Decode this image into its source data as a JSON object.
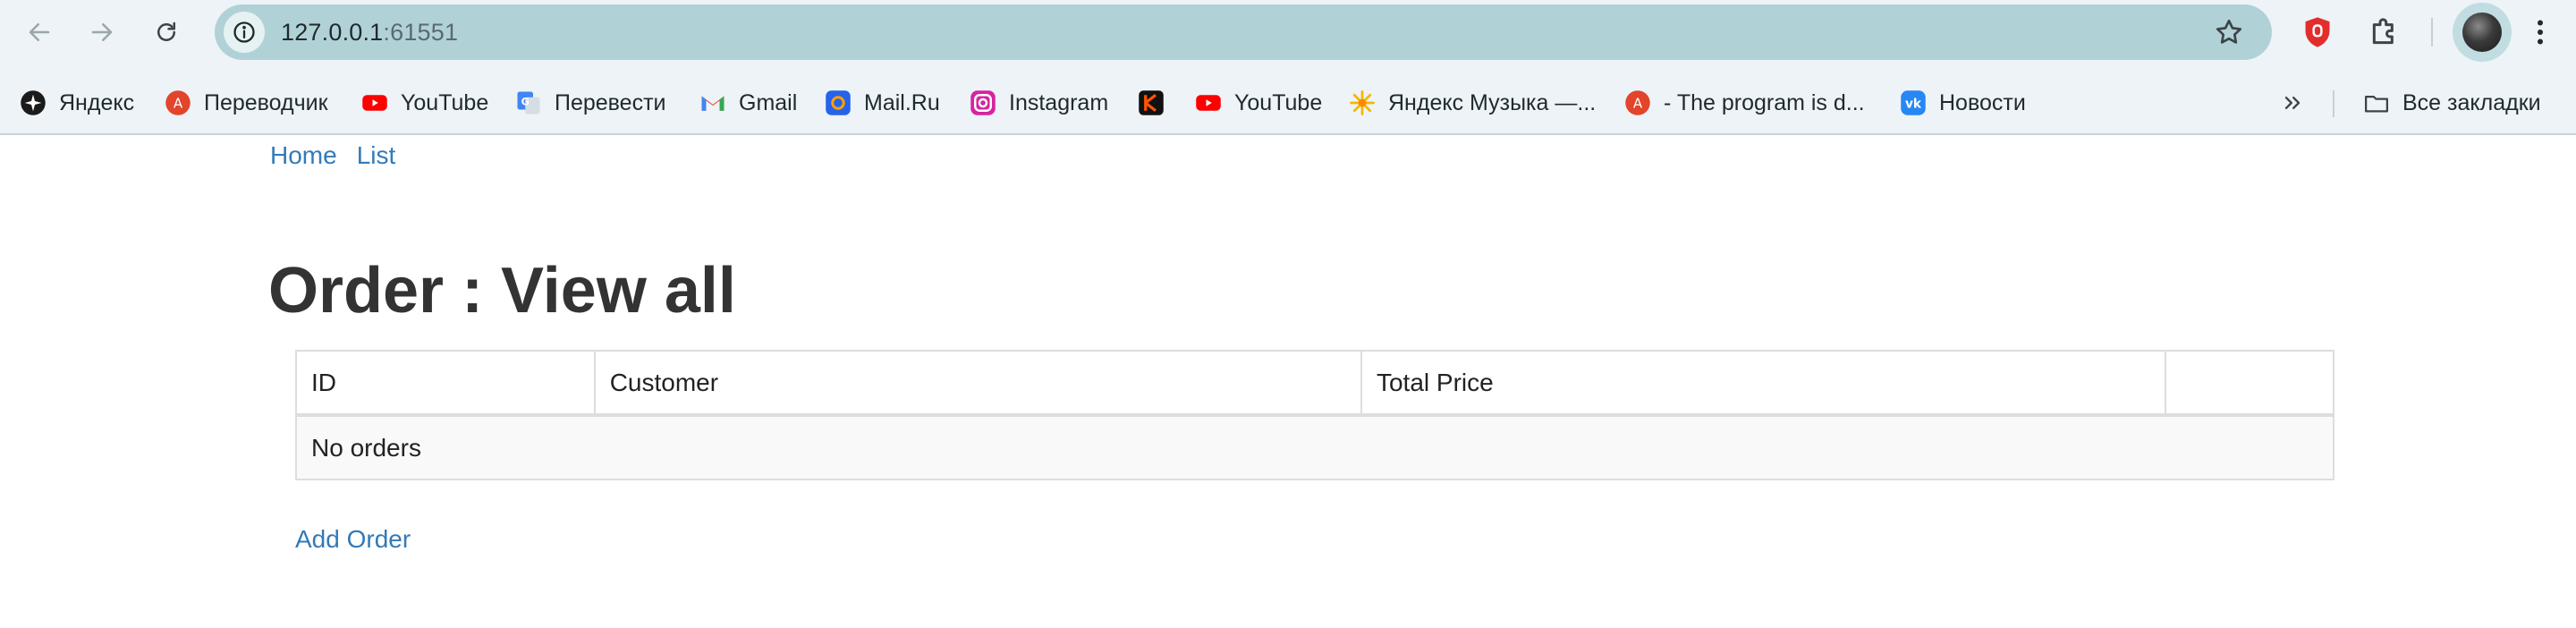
{
  "browser": {
    "url_host": "127.0.0.1",
    "url_port": ":61551",
    "icons": {
      "back": "arrow-left-icon",
      "forward": "arrow-right-icon",
      "reload": "reload-icon",
      "site_info": "info-icon",
      "bookmark_star": "star-icon",
      "extension_shield": "shield-icon",
      "extensions": "puzzle-icon",
      "menu": "kebab-menu-icon"
    }
  },
  "bookmarks": {
    "items": [
      {
        "label": "Яндекс",
        "icon": "yandex-icon"
      },
      {
        "label": "Переводчик",
        "icon": "translator-icon"
      },
      {
        "label": "YouTube",
        "icon": "youtube-icon"
      },
      {
        "label": "Перевести",
        "icon": "google-translate-icon"
      },
      {
        "label": "Gmail",
        "icon": "gmail-icon"
      },
      {
        "label": "Mail.Ru",
        "icon": "mailru-icon"
      },
      {
        "label": "Instagram",
        "icon": "instagram-icon"
      },
      {
        "label": "",
        "icon": "kinopoisk-icon"
      },
      {
        "label": "YouTube",
        "icon": "youtube-icon"
      },
      {
        "label": "Яндекс Музыка —...",
        "icon": "yandex-music-icon"
      },
      {
        "label": "- The program is d...",
        "icon": "translator-icon"
      },
      {
        "label": "Новости",
        "icon": "vk-icon"
      }
    ],
    "all_bookmarks_label": "Все закладки",
    "all_bookmarks_icon": "folder-icon",
    "more_icon": "double-chevron-right-icon"
  },
  "nav": {
    "home": "Home",
    "list": "List"
  },
  "page": {
    "title": "Order : View all",
    "table": {
      "headers": [
        "ID",
        "Customer",
        "Total Price",
        ""
      ],
      "empty_message": "No orders"
    },
    "add_link": "Add Order"
  },
  "colors": {
    "link": "#337ab7",
    "title": "#333333",
    "omnibox": "#b0d2d6",
    "chrome_bg": "#edf3f6",
    "youtube_red": "#ff0000"
  }
}
